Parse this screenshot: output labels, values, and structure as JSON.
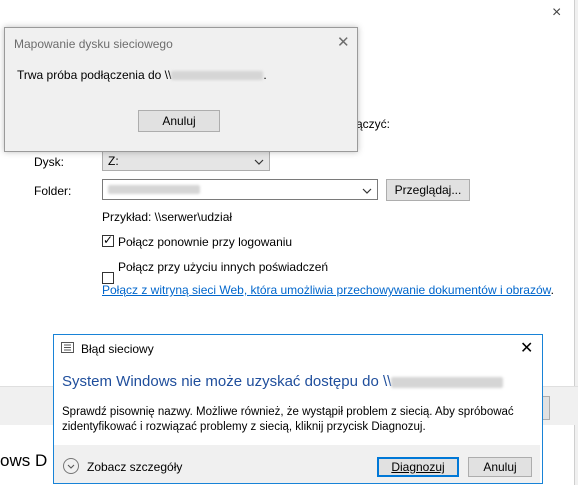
{
  "wizard": {
    "close_glyph": "×",
    "partial_label": "ączyć:",
    "drive_label": "Dysk:",
    "drive_value": "Z:",
    "folder_label": "Folder:",
    "browse_label": "Przeglądaj...",
    "example_label": "Przykład: \\\\serwer\\udział",
    "reconnect_label": "Połącz ponownie przy logowaniu",
    "reconnect_checked": true,
    "other_credentials_label": "Połącz przy użyciu innych poświadczeń",
    "other_credentials_checked": false,
    "website_link": "Połącz z witryną sieci Web, która umożliwia przechowywanie dokumentów i obrazów",
    "link_suffix": ".",
    "behind_text": "ows D"
  },
  "mapping_dialog": {
    "title": "Mapowanie dysku sieciowego",
    "message_prefix": "Trwa próba podłączenia do \\\\",
    "message_suffix": ".",
    "cancel_label": "Anuluj",
    "close_glyph": "✕"
  },
  "error_dialog": {
    "title": "Błąd sieciowy",
    "close_glyph": "✕",
    "heading": "System Windows nie może uzyskać dostępu do \\\\",
    "body": "Sprawdź pisownię nazwy. Możliwe również, że wystąpił problem z siecią. Aby spróbować zidentyfikować i rozwiązać problemy z siecią, kliknij przycisk Diagnozuj.",
    "details_label": "Zobacz szczegóły",
    "diagnose_label": "Diagnozuj",
    "cancel_label": "Anuluj",
    "heading_color": "#1f4e9c"
  }
}
